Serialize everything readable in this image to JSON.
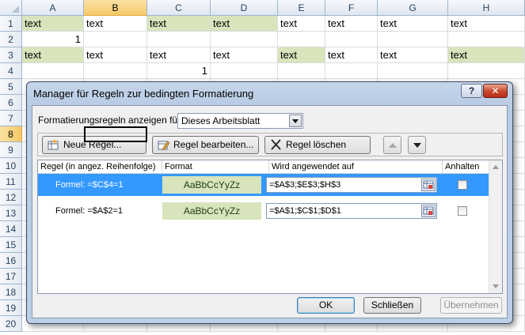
{
  "sheet": {
    "columns": [
      "A",
      "B",
      "C",
      "D",
      "E",
      "F",
      "G",
      "H"
    ],
    "rows": [
      "1",
      "2",
      "3",
      "4",
      "5",
      "6",
      "7",
      "8",
      "9",
      "10",
      "11",
      "12",
      "13",
      "14",
      "15",
      "16",
      "17",
      "18",
      "19",
      "20"
    ],
    "selected_column": "B",
    "selected_row": "8",
    "cells": {
      "A1": "text",
      "B1": "text",
      "C1": "text",
      "D1": "text",
      "E1": "text",
      "F1": "text",
      "G1": "text",
      "H1": "text",
      "A2": "1",
      "A3": "text",
      "B3": "text",
      "C3": "text",
      "D3": "text",
      "E3": "text",
      "F3": "text",
      "G3": "text",
      "H3": "text",
      "C4": "1"
    },
    "green_cells": [
      "A1",
      "C1",
      "D1",
      "A3",
      "E3",
      "H3"
    ],
    "highlight_color": "#d8e4bc"
  },
  "dialog": {
    "title": "Manager für Regeln zur bedingten Formatierung",
    "help_label": "?",
    "close_label": "✕",
    "show_rules_label": "Formatierungsregeln anzeigen für:",
    "show_rules_value": "Dieses Arbeitsblatt",
    "toolbar": {
      "new_rule": "Neue Regel...",
      "edit_rule": "Regel bearbeiten...",
      "delete_rule": "Regel löschen"
    },
    "headers": {
      "rule": "Regel (in angez. Reihenfolge)",
      "format": "Format",
      "applies_to": "Wird angewendet auf",
      "stop": "Anhalten"
    },
    "rules": [
      {
        "condition": "Formel: =$C$4=1",
        "preview": "AaBbCcYyZz",
        "range": "=$A$3;$E$3;$H$3",
        "stop": false,
        "selected": true
      },
      {
        "condition": "Formel: =$A$2=1",
        "preview": "AaBbCcYyZz",
        "range": "=$A$1;$C$1;$D$1",
        "stop": false,
        "selected": false
      }
    ],
    "buttons": {
      "ok": "OK",
      "close": "Schließen",
      "apply": "Übernehmen"
    },
    "icons": [
      "new-rule-icon",
      "edit-rule-icon",
      "delete-rule-icon",
      "move-up-icon",
      "move-down-icon",
      "range-select-icon",
      "dropdown-arrow-icon"
    ]
  }
}
